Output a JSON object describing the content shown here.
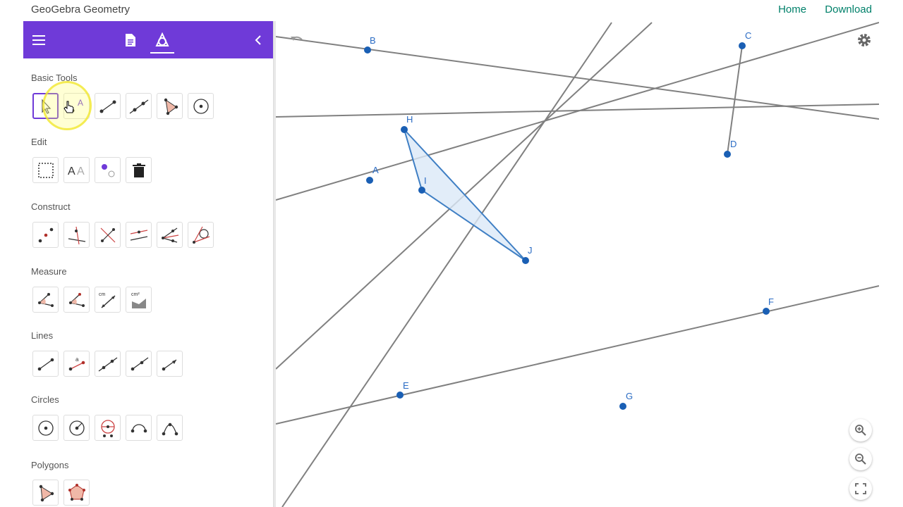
{
  "app": {
    "title": "GeoGebra Geometry"
  },
  "top_links": {
    "home": "Home",
    "download": "Download"
  },
  "sidebar": {
    "sections": {
      "basic": "Basic Tools",
      "edit": "Edit",
      "construct": "Construct",
      "measure": "Measure",
      "lines": "Lines",
      "circles": "Circles",
      "polygons": "Polygons"
    },
    "tool_text": {
      "label_tool": "A",
      "style_a1": "A",
      "style_a2": "A",
      "lines_text_a": "a",
      "cm": "cm",
      "cm2": "cm²"
    }
  },
  "points": {
    "A": "A",
    "B": "B",
    "C": "C",
    "D": "D",
    "E": "E",
    "F": "F",
    "G": "G",
    "H": "H",
    "I": "I",
    "J": "J"
  },
  "colors": {
    "accent": "#6f3ad8",
    "link": "#00806a",
    "point": "#1a5fb4",
    "polygon_fill": "#dbe8f7",
    "line": "#808080"
  },
  "icons": [
    "menu-icon",
    "document-icon",
    "geometry-tools-icon",
    "collapse-icon",
    "settings-gear-icon",
    "undo-icon",
    "zoom-in-icon",
    "zoom-out-icon",
    "fullscreen-icon"
  ]
}
